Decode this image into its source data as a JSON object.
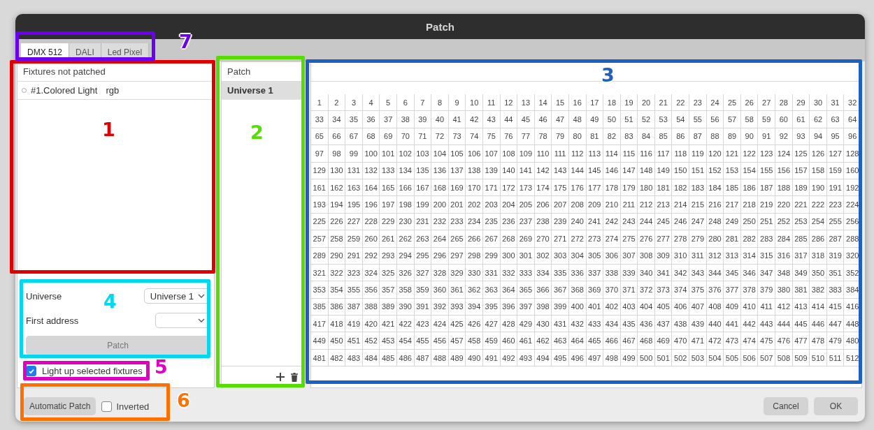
{
  "window": {
    "title": "Patch"
  },
  "tabs": [
    {
      "label": "DMX 512",
      "selected": true
    },
    {
      "label": "DALI",
      "selected": false
    },
    {
      "label": "Led Pixel",
      "selected": false
    }
  ],
  "fixtures": {
    "header": "Fixtures not patched",
    "items": [
      {
        "name": "#1.Colored Light",
        "type": "rgb"
      }
    ]
  },
  "form": {
    "universe_label": "Universe",
    "universe_value": "Universe 1",
    "address_label": "First address",
    "patch_button": {
      "label": "Patch",
      "disabled": true
    }
  },
  "light_up": {
    "label": "Light up selected fixtures",
    "checked": true
  },
  "universes": {
    "header": "Patch",
    "items": [
      {
        "label": "Universe 1",
        "selected": true
      }
    ]
  },
  "channel_grid": {
    "rows": [
      [
        "1",
        "2",
        "3",
        "4",
        "5",
        "6",
        "7",
        "8",
        "9",
        "10",
        "11",
        "12",
        "13",
        "14",
        "15",
        "16",
        "17",
        "18",
        "19",
        "20",
        "21",
        "22",
        "23",
        "24",
        "25",
        "26",
        "27",
        "28",
        "29",
        "30",
        "31",
        "32"
      ],
      [
        "33",
        "34",
        "35",
        "36",
        "37",
        "38",
        "39",
        "40",
        "41",
        "42",
        "43",
        "44",
        "45",
        "46",
        "47",
        "48",
        "49",
        "50",
        "51",
        "52",
        "53",
        "54",
        "55",
        "56",
        "57",
        "58",
        "59",
        "60",
        "61",
        "62",
        "63",
        "64"
      ],
      [
        "65",
        "66",
        "67",
        "68",
        "69",
        "70",
        "71",
        "72",
        "73",
        "74",
        "75",
        "76",
        "77",
        "78",
        "79",
        "80",
        "81",
        "82",
        "83",
        "84",
        "85",
        "86",
        "87",
        "88",
        "89",
        "90",
        "91",
        "92",
        "93",
        "94",
        "95",
        "96"
      ],
      [
        "97",
        "98",
        "99",
        "100",
        "101",
        "102",
        "103",
        "104",
        "105",
        "106",
        "107",
        "108",
        "109",
        "110",
        "111",
        "112",
        "113",
        "114",
        "115",
        "116",
        "117",
        "118",
        "119",
        "120",
        "121",
        "122",
        "123",
        "124",
        "125",
        "126",
        "127",
        "128"
      ],
      [
        "129",
        "130",
        "131",
        "132",
        "133",
        "134",
        "135",
        "136",
        "137",
        "138",
        "139",
        "140",
        "141",
        "142",
        "143",
        "144",
        "145",
        "146",
        "147",
        "148",
        "149",
        "150",
        "151",
        "152",
        "153",
        "154",
        "155",
        "156",
        "157",
        "158",
        "159",
        "160"
      ],
      [
        "161",
        "162",
        "163",
        "164",
        "165",
        "166",
        "167",
        "168",
        "169",
        "170",
        "171",
        "172",
        "173",
        "174",
        "175",
        "176",
        "177",
        "178",
        "179",
        "180",
        "181",
        "182",
        "183",
        "184",
        "185",
        "186",
        "187",
        "188",
        "189",
        "190",
        "191",
        "192"
      ],
      [
        "193",
        "194",
        "195",
        "196",
        "197",
        "198",
        "199",
        "200",
        "201",
        "202",
        "203",
        "204",
        "205",
        "206",
        "207",
        "208",
        "209",
        "210",
        "211",
        "212",
        "213",
        "214",
        "215",
        "216",
        "217",
        "218",
        "219",
        "220",
        "221",
        "222",
        "223",
        "224"
      ],
      [
        "225",
        "226",
        "227",
        "228",
        "229",
        "230",
        "231",
        "232",
        "233",
        "234",
        "235",
        "236",
        "237",
        "238",
        "239",
        "240",
        "241",
        "242",
        "243",
        "244",
        "245",
        "246",
        "247",
        "248",
        "249",
        "250",
        "251",
        "252",
        "253",
        "254",
        "255",
        "256"
      ],
      [
        "257",
        "258",
        "259",
        "260",
        "261",
        "262",
        "263",
        "264",
        "265",
        "266",
        "267",
        "268",
        "269",
        "270",
        "271",
        "272",
        "273",
        "274",
        "275",
        "276",
        "277",
        "278",
        "279",
        "280",
        "281",
        "282",
        "283",
        "284",
        "285",
        "286",
        "287",
        "288"
      ],
      [
        "289",
        "290",
        "291",
        "292",
        "293",
        "294",
        "295",
        "296",
        "297",
        "298",
        "299",
        "300",
        "301",
        "302",
        "303",
        "304",
        "305",
        "306",
        "307",
        "308",
        "309",
        "310",
        "311",
        "312",
        "313",
        "314",
        "315",
        "316",
        "317",
        "318",
        "319",
        "320"
      ],
      [
        "321",
        "322",
        "323",
        "324",
        "325",
        "326",
        "327",
        "328",
        "329",
        "330",
        "331",
        "332",
        "333",
        "334",
        "335",
        "336",
        "337",
        "338",
        "339",
        "340",
        "341",
        "342",
        "343",
        "344",
        "345",
        "346",
        "347",
        "348",
        "349",
        "350",
        "351",
        "352"
      ],
      [
        "353",
        "354",
        "355",
        "356",
        "357",
        "358",
        "359",
        "360",
        "361",
        "362",
        "363",
        "364",
        "365",
        "366",
        "367",
        "368",
        "369",
        "370",
        "371",
        "372",
        "373",
        "374",
        "375",
        "376",
        "377",
        "378",
        "379",
        "380",
        "381",
        "382",
        "383",
        "384"
      ],
      [
        "385",
        "386",
        "387",
        "388",
        "389",
        "390",
        "391",
        "392",
        "393",
        "394",
        "395",
        "396",
        "397",
        "398",
        "399",
        "400",
        "401",
        "402",
        "403",
        "404",
        "405",
        "406",
        "407",
        "408",
        "409",
        "410",
        "411",
        "412",
        "413",
        "414",
        "415",
        "416"
      ],
      [
        "417",
        "418",
        "419",
        "420",
        "421",
        "422",
        "423",
        "424",
        "425",
        "426",
        "427",
        "428",
        "429",
        "430",
        "431",
        "432",
        "433",
        "434",
        "435",
        "436",
        "437",
        "438",
        "439",
        "440",
        "441",
        "442",
        "443",
        "444",
        "445",
        "446",
        "447",
        "448"
      ],
      [
        "449",
        "450",
        "451",
        "452",
        "453",
        "454",
        "455",
        "456",
        "457",
        "458",
        "459",
        "460",
        "461",
        "462",
        "463",
        "464",
        "465",
        "466",
        "467",
        "468",
        "469",
        "470",
        "471",
        "472",
        "473",
        "474",
        "475",
        "476",
        "477",
        "478",
        "479",
        "480"
      ],
      [
        "481",
        "482",
        "483",
        "484",
        "485",
        "486",
        "487",
        "488",
        "489",
        "490",
        "491",
        "492",
        "493",
        "494",
        "495",
        "496",
        "497",
        "498",
        "499",
        "500",
        "501",
        "502",
        "503",
        "504",
        "505",
        "506",
        "507",
        "508",
        "509",
        "510",
        "511",
        "512"
      ]
    ]
  },
  "footer": {
    "auto_patch": "Automatic Patch",
    "inverted": {
      "label": "Inverted",
      "checked": false
    },
    "buttons": [
      "Cancel",
      "OK"
    ]
  },
  "annotations": [
    {
      "label": "1",
      "color": "#e00000"
    },
    {
      "label": "2",
      "color": "#55dd00"
    },
    {
      "label": "3",
      "color": "#1f5fc0"
    },
    {
      "label": "4",
      "color": "#00d8f0"
    },
    {
      "label": "5",
      "color": "#e000c0"
    },
    {
      "label": "6",
      "color": "#ff7000"
    },
    {
      "label": "7",
      "color": "#6a00f0"
    }
  ]
}
